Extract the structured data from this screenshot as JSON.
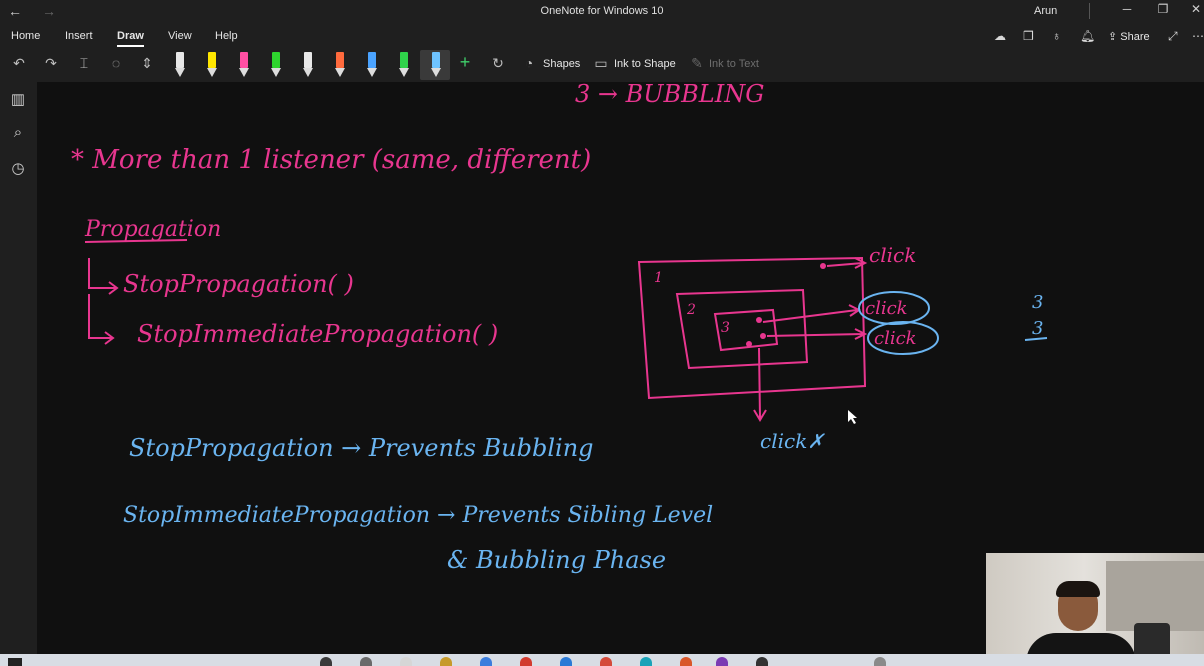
{
  "window": {
    "title": "OneNote for Windows 10",
    "user": "Arun"
  },
  "menu_tabs": [
    "Home",
    "Insert",
    "Draw",
    "View",
    "Help"
  ],
  "share_label": "Share",
  "toolbar": {
    "shapes_label": "Shapes",
    "ink_to_shape_label": "Ink to Shape",
    "ink_to_text_label": "Ink to Text",
    "pens": [
      {
        "color": "#e8e8e8"
      },
      {
        "color": "#ffe600"
      },
      {
        "color": "#ff4fa3"
      },
      {
        "color": "#2ed52e"
      },
      {
        "color": "#e8e8e8"
      },
      {
        "color": "#ff6a3d"
      },
      {
        "color": "#4aa3ff"
      },
      {
        "color": "#2fd24a"
      },
      {
        "color": "#6ec3ff"
      }
    ]
  },
  "ink": {
    "top_partial": "3 → BUBBLING",
    "heading_note": "* More than 1 listener (same, different)",
    "propagation_title": "Propagation",
    "method_1": "StopPropagation( )",
    "method_2": "StopImmediatePropagation( )",
    "diagram_labels": {
      "outer": "1",
      "middle": "2",
      "inner": "3",
      "click_top": "click",
      "click_1": "click",
      "click_2": "click",
      "click_blocked": "click✗",
      "count_1": "3",
      "count_2": "3"
    },
    "blue_line_1": "StopPropagation → Prevents Bubbling",
    "blue_line_2": "StopImmediatePropagation → Prevents Sibling Level",
    "blue_line_3": "& Bubbling Phase"
  },
  "colors": {
    "pink_ink": "#e8368f",
    "blue_ink": "#6ab4f0"
  }
}
